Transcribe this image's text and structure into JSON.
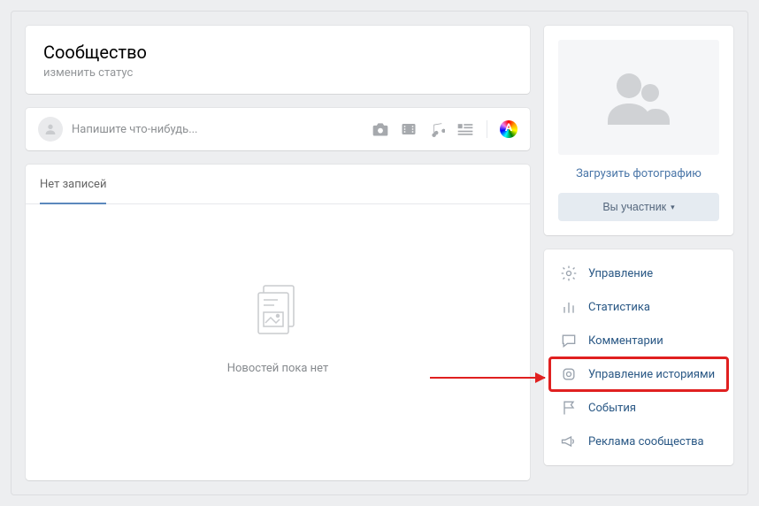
{
  "header": {
    "title": "Сообщество",
    "change_status": "изменить статус"
  },
  "composer": {
    "placeholder": "Напишите что-нибудь..."
  },
  "wall": {
    "tab_label": "Нет записей",
    "empty_text": "Новостей пока нет"
  },
  "sidebar": {
    "upload_photo": "Загрузить фотографию",
    "member_button": "Вы участник",
    "menu": [
      {
        "label": "Управление"
      },
      {
        "label": "Статистика"
      },
      {
        "label": "Комментарии"
      },
      {
        "label": "Управление историями"
      },
      {
        "label": "События"
      },
      {
        "label": "Реклама сообщества"
      }
    ]
  }
}
